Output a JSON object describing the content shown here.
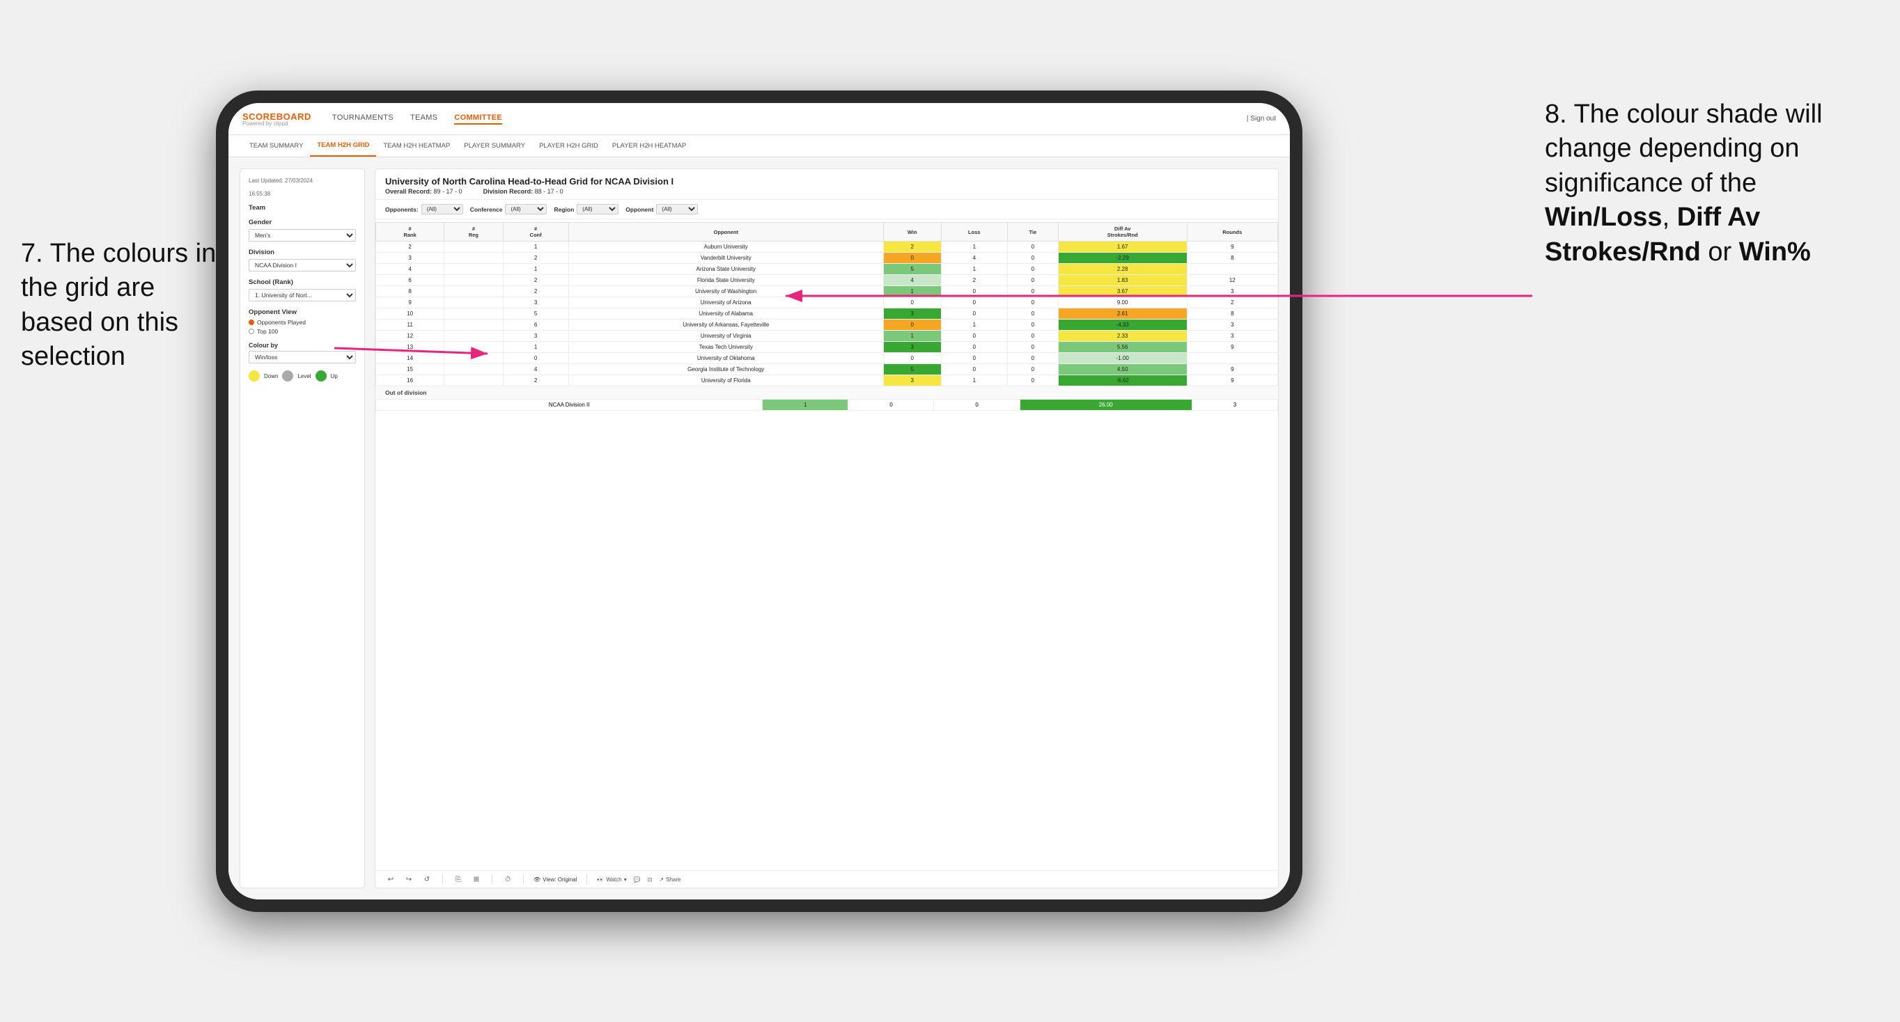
{
  "annotations": {
    "left": "7. The colours in the grid are based on this selection",
    "right_prefix": "8. The colour shade will change depending on significance of the ",
    "right_bold1": "Win/Loss",
    "right_sep1": ", ",
    "right_bold2": "Diff Av Strokes/Rnd",
    "right_sep2": " or ",
    "right_bold3": "Win%"
  },
  "nav": {
    "logo": "SCOREBOARD",
    "logo_sub": "Powered by clippd",
    "links": [
      "TOURNAMENTS",
      "TEAMS",
      "COMMITTEE"
    ],
    "active_link": "COMMITTEE",
    "sign_out": "Sign out"
  },
  "sub_nav": {
    "links": [
      "TEAM SUMMARY",
      "TEAM H2H GRID",
      "TEAM H2H HEATMAP",
      "PLAYER SUMMARY",
      "PLAYER H2H GRID",
      "PLAYER H2H HEATMAP"
    ],
    "active": "TEAM H2H GRID"
  },
  "left_panel": {
    "date_label": "Last Updated: 27/03/2024",
    "time_label": "16:55:38",
    "team_label": "Team",
    "gender_label": "Gender",
    "gender_value": "Men's",
    "division_label": "Division",
    "division_value": "NCAA Division I",
    "school_label": "School (Rank)",
    "school_value": "1. University of Nort...",
    "opponent_view_label": "Opponent View",
    "radio1": "Opponents Played",
    "radio2": "Top 100",
    "colour_by_label": "Colour by",
    "colour_by_value": "Win/loss",
    "legend": [
      {
        "color": "#f5e642",
        "label": "Down"
      },
      {
        "color": "#aaaaaa",
        "label": "Level"
      },
      {
        "color": "#38a833",
        "label": "Up"
      }
    ]
  },
  "grid": {
    "title": "University of North Carolina Head-to-Head Grid for NCAA Division I",
    "overall_record_label": "Overall Record:",
    "overall_record": "89 - 17 - 0",
    "division_record_label": "Division Record:",
    "division_record": "88 - 17 - 0",
    "filters": {
      "opponents_label": "Opponents:",
      "opponents_value": "(All)",
      "conference_label": "Conference",
      "conference_value": "(All)",
      "region_label": "Region",
      "region_value": "(All)",
      "opponent_label": "Opponent",
      "opponent_value": "(All)"
    },
    "columns": [
      "#\nRank",
      "#\nReg",
      "#\nConf",
      "Opponent",
      "Win",
      "Loss",
      "Tie",
      "Diff Av\nStrokes/Rnd",
      "Rounds"
    ],
    "rows": [
      {
        "rank": "2",
        "reg": "",
        "conf": "1",
        "opponent": "Auburn University",
        "win": "2",
        "loss": "1",
        "tie": "0",
        "diff": "1.67",
        "rounds": "9",
        "win_color": "cell-yellow",
        "diff_color": "cell-yellow"
      },
      {
        "rank": "3",
        "reg": "",
        "conf": "2",
        "opponent": "Vanderbilt University",
        "win": "0",
        "loss": "4",
        "tie": "0",
        "diff": "-2.29",
        "rounds": "8",
        "win_color": "cell-orange",
        "diff_color": "cell-green-dark"
      },
      {
        "rank": "4",
        "reg": "",
        "conf": "1",
        "opponent": "Arizona State University",
        "win": "5",
        "loss": "1",
        "tie": "0",
        "diff": "2.28",
        "rounds": "",
        "win_color": "cell-green-mid",
        "diff_color": "cell-yellow"
      },
      {
        "rank": "6",
        "reg": "",
        "conf": "2",
        "opponent": "Florida State University",
        "win": "4",
        "loss": "2",
        "tie": "0",
        "diff": "1.83",
        "rounds": "12",
        "win_color": "cell-green-light",
        "diff_color": "cell-yellow"
      },
      {
        "rank": "8",
        "reg": "",
        "conf": "2",
        "opponent": "University of Washington",
        "win": "1",
        "loss": "0",
        "tie": "0",
        "diff": "3.67",
        "rounds": "3",
        "win_color": "cell-green-mid",
        "diff_color": "cell-yellow"
      },
      {
        "rank": "9",
        "reg": "",
        "conf": "3",
        "opponent": "University of Arizona",
        "win": "0",
        "loss": "0",
        "tie": "0",
        "diff": "9.00",
        "rounds": "2",
        "win_color": "cell-plain",
        "diff_color": "cell-plain"
      },
      {
        "rank": "10",
        "reg": "",
        "conf": "5",
        "opponent": "University of Alabama",
        "win": "3",
        "loss": "0",
        "tie": "0",
        "diff": "2.61",
        "rounds": "8",
        "win_color": "cell-green-dark",
        "diff_color": "cell-orange"
      },
      {
        "rank": "11",
        "reg": "",
        "conf": "6",
        "opponent": "University of Arkansas, Fayetteville",
        "win": "0",
        "loss": "1",
        "tie": "0",
        "diff": "-4.33",
        "rounds": "3",
        "win_color": "cell-orange",
        "diff_color": "cell-green-dark"
      },
      {
        "rank": "12",
        "reg": "",
        "conf": "3",
        "opponent": "University of Virginia",
        "win": "1",
        "loss": "0",
        "tie": "0",
        "diff": "2.33",
        "rounds": "3",
        "win_color": "cell-green-mid",
        "diff_color": "cell-yellow"
      },
      {
        "rank": "13",
        "reg": "",
        "conf": "1",
        "opponent": "Texas Tech University",
        "win": "3",
        "loss": "0",
        "tie": "0",
        "diff": "5.56",
        "rounds": "9",
        "win_color": "cell-green-dark",
        "diff_color": "cell-green-mid"
      },
      {
        "rank": "14",
        "reg": "",
        "conf": "0",
        "opponent": "University of Oklahoma",
        "win": "0",
        "loss": "0",
        "tie": "0",
        "diff": "-1.00",
        "rounds": "",
        "win_color": "cell-plain",
        "diff_color": "cell-green-light"
      },
      {
        "rank": "15",
        "reg": "",
        "conf": "4",
        "opponent": "Georgia Institute of Technology",
        "win": "5",
        "loss": "0",
        "tie": "0",
        "diff": "4.50",
        "rounds": "9",
        "win_color": "cell-green-dark",
        "diff_color": "cell-green-mid"
      },
      {
        "rank": "16",
        "reg": "",
        "conf": "2",
        "opponent": "University of Florida",
        "win": "3",
        "loss": "1",
        "tie": "0",
        "diff": "-6.62",
        "rounds": "9",
        "win_color": "cell-yellow",
        "diff_color": "cell-green-dark"
      }
    ],
    "out_of_division": {
      "label": "Out of division",
      "rows": [
        {
          "opponent": "NCAA Division II",
          "win": "1",
          "loss": "0",
          "tie": "0",
          "diff": "26.00",
          "rounds": "3",
          "win_color": "cell-green-mid",
          "diff_color": "cell-green-dark"
        }
      ]
    }
  },
  "toolbar": {
    "view_label": "View: Original",
    "watch_label": "Watch",
    "share_label": "Share"
  }
}
